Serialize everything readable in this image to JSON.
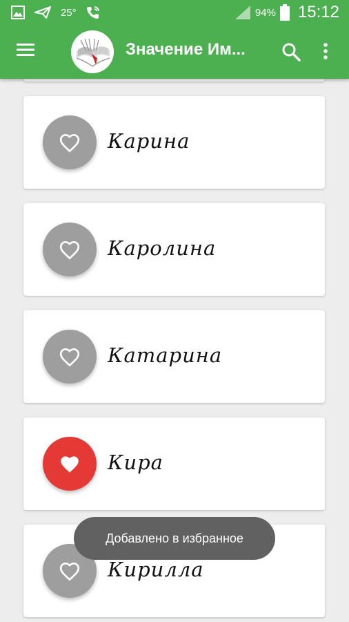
{
  "status_bar": {
    "temperature": "25°",
    "battery": "94%",
    "time": "15:12",
    "icons": [
      "gallery-icon",
      "send-icon",
      "phone-wifi-icon",
      "signal-icon",
      "battery-icon"
    ]
  },
  "toolbar": {
    "title": "Значение Им...",
    "icons": [
      "menu-icon",
      "book-logo-icon",
      "search-icon",
      "more-vert-icon"
    ],
    "background_color": "#4caf50"
  },
  "names_list": {
    "items": [
      {
        "name": "Карина",
        "favorite": false
      },
      {
        "name": "Каролина",
        "favorite": false
      },
      {
        "name": "Катарина",
        "favorite": false
      },
      {
        "name": "Кира",
        "favorite": true
      },
      {
        "name": "Кирилла",
        "favorite": false
      }
    ],
    "colors": {
      "favorite_on": "#e53935",
      "favorite_off": "#9e9e9e"
    }
  },
  "toast": {
    "message": "Добавлено в избранное"
  }
}
